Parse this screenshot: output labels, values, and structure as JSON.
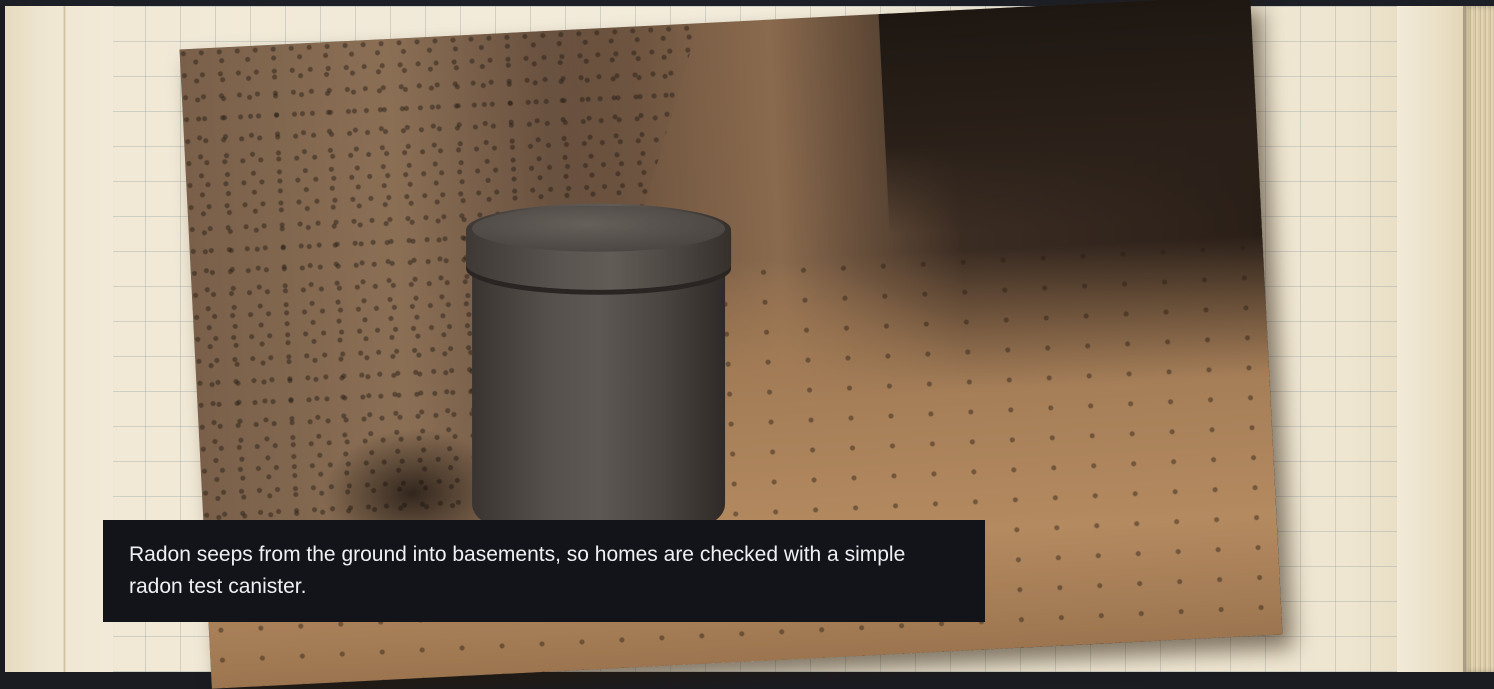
{
  "slide": {
    "caption": "Radon seeps from the ground into basements, so homes are checked with a simple radon test canister."
  },
  "colors": {
    "caption_background": "#131419",
    "caption_text": "#eef0f3",
    "paper": "#f1e9d6",
    "grid_lines": "#9aa6ab"
  },
  "icons": {
    "photo": "radon-test-canister-photo"
  }
}
